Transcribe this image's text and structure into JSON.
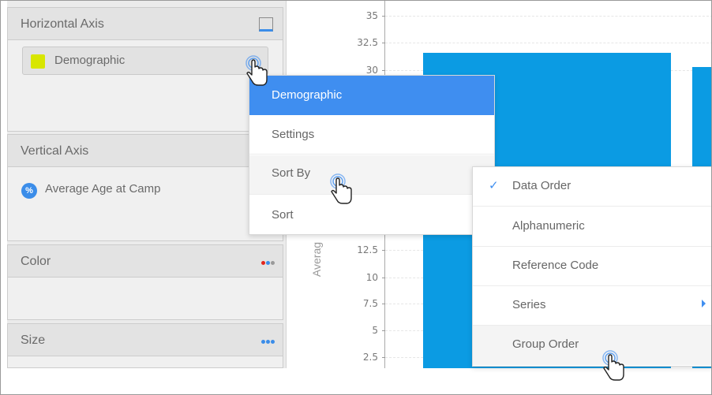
{
  "panel": {
    "horizontal_axis": {
      "title": "Horizontal Axis",
      "field": "Demographic"
    },
    "vertical_axis": {
      "title": "Vertical Axis",
      "field": "Average Age at Camp",
      "field_badge": "%"
    },
    "color": {
      "title": "Color"
    },
    "size": {
      "title": "Size"
    }
  },
  "chart": {
    "ylabel_visible": "Averag",
    "y_ticks": [
      "35",
      "32.5",
      "30",
      "12.5",
      "10",
      "7.5",
      "5",
      "2.5"
    ]
  },
  "context_menu": {
    "header": "Demographic",
    "items": [
      "Settings",
      "Sort By",
      "Sort"
    ]
  },
  "sort_submenu": {
    "items": [
      "Data Order",
      "Alphanumeric",
      "Reference Code",
      "Series",
      "Group Order"
    ],
    "checked": "Data Order",
    "checkmark": "✓"
  },
  "colors": {
    "accent": "#3f8ef0",
    "bar": "#0b9be3",
    "swatch": "#d8e600"
  },
  "icons": [
    "axis-icon",
    "percent-icon",
    "color-dots-icon",
    "size-dots-icon",
    "check-icon",
    "submenu-caret-icon",
    "hand-cursor-icon"
  ]
}
